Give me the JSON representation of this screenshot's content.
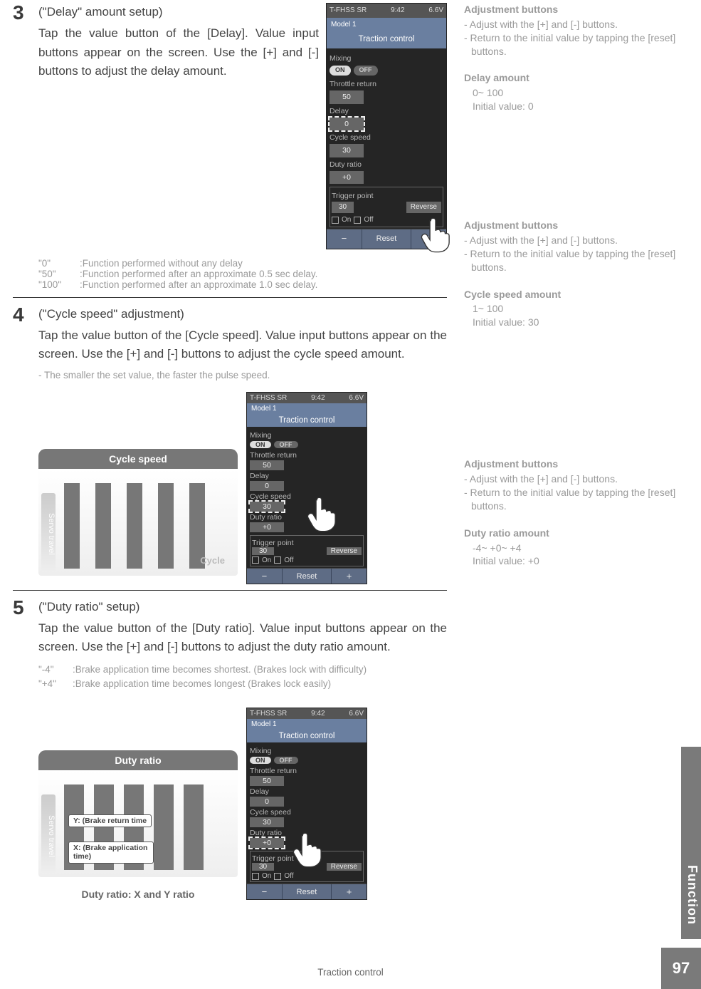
{
  "footer": {
    "title": "Traction control",
    "page_num": "97",
    "side_tab": "Function"
  },
  "device": {
    "top_left": "T-FHSS SR",
    "top_time": "9:42",
    "top_right": "6.6V",
    "model": "Model 1",
    "screen_title": "Traction control",
    "mixing_label": "Mixing",
    "on": "ON",
    "off": "OFF",
    "throttle_return_label": "Throttle return",
    "throttle_return_val": "50",
    "delay_label": "Delay",
    "delay_val": "0",
    "cycle_speed_label": "Cycle speed",
    "cycle_speed_val": "30",
    "duty_ratio_label": "Duty ratio",
    "duty_ratio_val": "+0",
    "trigger_point_label": "Trigger point",
    "trigger_val": "30",
    "reverse": "Reverse",
    "chk_on": "On",
    "chk_off": "Off",
    "minus": "−",
    "plus": "+",
    "reset": "Reset"
  },
  "step3": {
    "num": "3",
    "title": "(\"Delay\" amount setup)",
    "desc": "Tap the value button of the [Delay]. Value input buttons appear on the screen. Use the [+] and [-] buttons to adjust the delay amount.",
    "notes": [
      {
        "k": "\"0\"",
        "v": ":Function performed without any delay"
      },
      {
        "k": "\"50\"",
        "v": ":Function performed after an approximate 0.5 sec delay."
      },
      {
        "k": "\"100\"",
        "v": ":Function performed after an approximate 1.0 sec delay."
      }
    ]
  },
  "step4": {
    "num": "4",
    "title": "(\"Cycle speed\" adjustment)",
    "desc": "Tap the value button of the [Cycle speed]. Value input buttons appear on the screen. Use the [+] and [-] buttons to adjust the cycle speed amount.",
    "sub": "- The smaller the set value, the faster the pulse speed.",
    "diagram_title": "Cycle speed",
    "servo_label": "Servo travel",
    "cycle_label": "Cycle"
  },
  "step5": {
    "num": "5",
    "title": "(\"Duty ratio\" setup)",
    "desc": "Tap the value button of the [Duty ratio]. Value input buttons appear on the screen. Use the [+] and [-] buttons to adjust the duty ratio amount.",
    "notes": [
      {
        "k": "\"-4\"",
        "v": ":Brake application time becomes shortest. (Brakes lock with difficulty)"
      },
      {
        "k": "\"+4\"",
        "v": ":Brake application time becomes longest (Brakes lock easily)"
      }
    ],
    "diagram_title": "Duty ratio",
    "servo_label": "Servo travel",
    "y_label": "Y: (Brake return time",
    "x_label": "X: (Brake application time)",
    "caption": "Duty ratio: X and Y ratio"
  },
  "side3": {
    "h1": "Adjustment buttons",
    "l1": "- Adjust with the [+] and [-] buttons.",
    "l2": "- Return to the initial value by tapping the [reset] buttons.",
    "h2": "Delay amount",
    "r1": "0~ 100",
    "r2": "Initial value: 0"
  },
  "side4": {
    "h1": "Adjustment buttons",
    "l1": "- Adjust with the [+] and [-] buttons.",
    "l2": "- Return to the initial value by tapping the [reset] buttons.",
    "h2": "Cycle speed amount",
    "r1": "1~ 100",
    "r2": "Initial value: 30"
  },
  "side5": {
    "h1": "Adjustment buttons",
    "l1": "- Adjust with the [+] and [-] buttons.",
    "l2": "- Return to the initial value by tapping the [reset] buttons.",
    "h2": "Duty ratio amount",
    "r1": "-4~ +0~ +4",
    "r2": "Initial value: +0"
  }
}
